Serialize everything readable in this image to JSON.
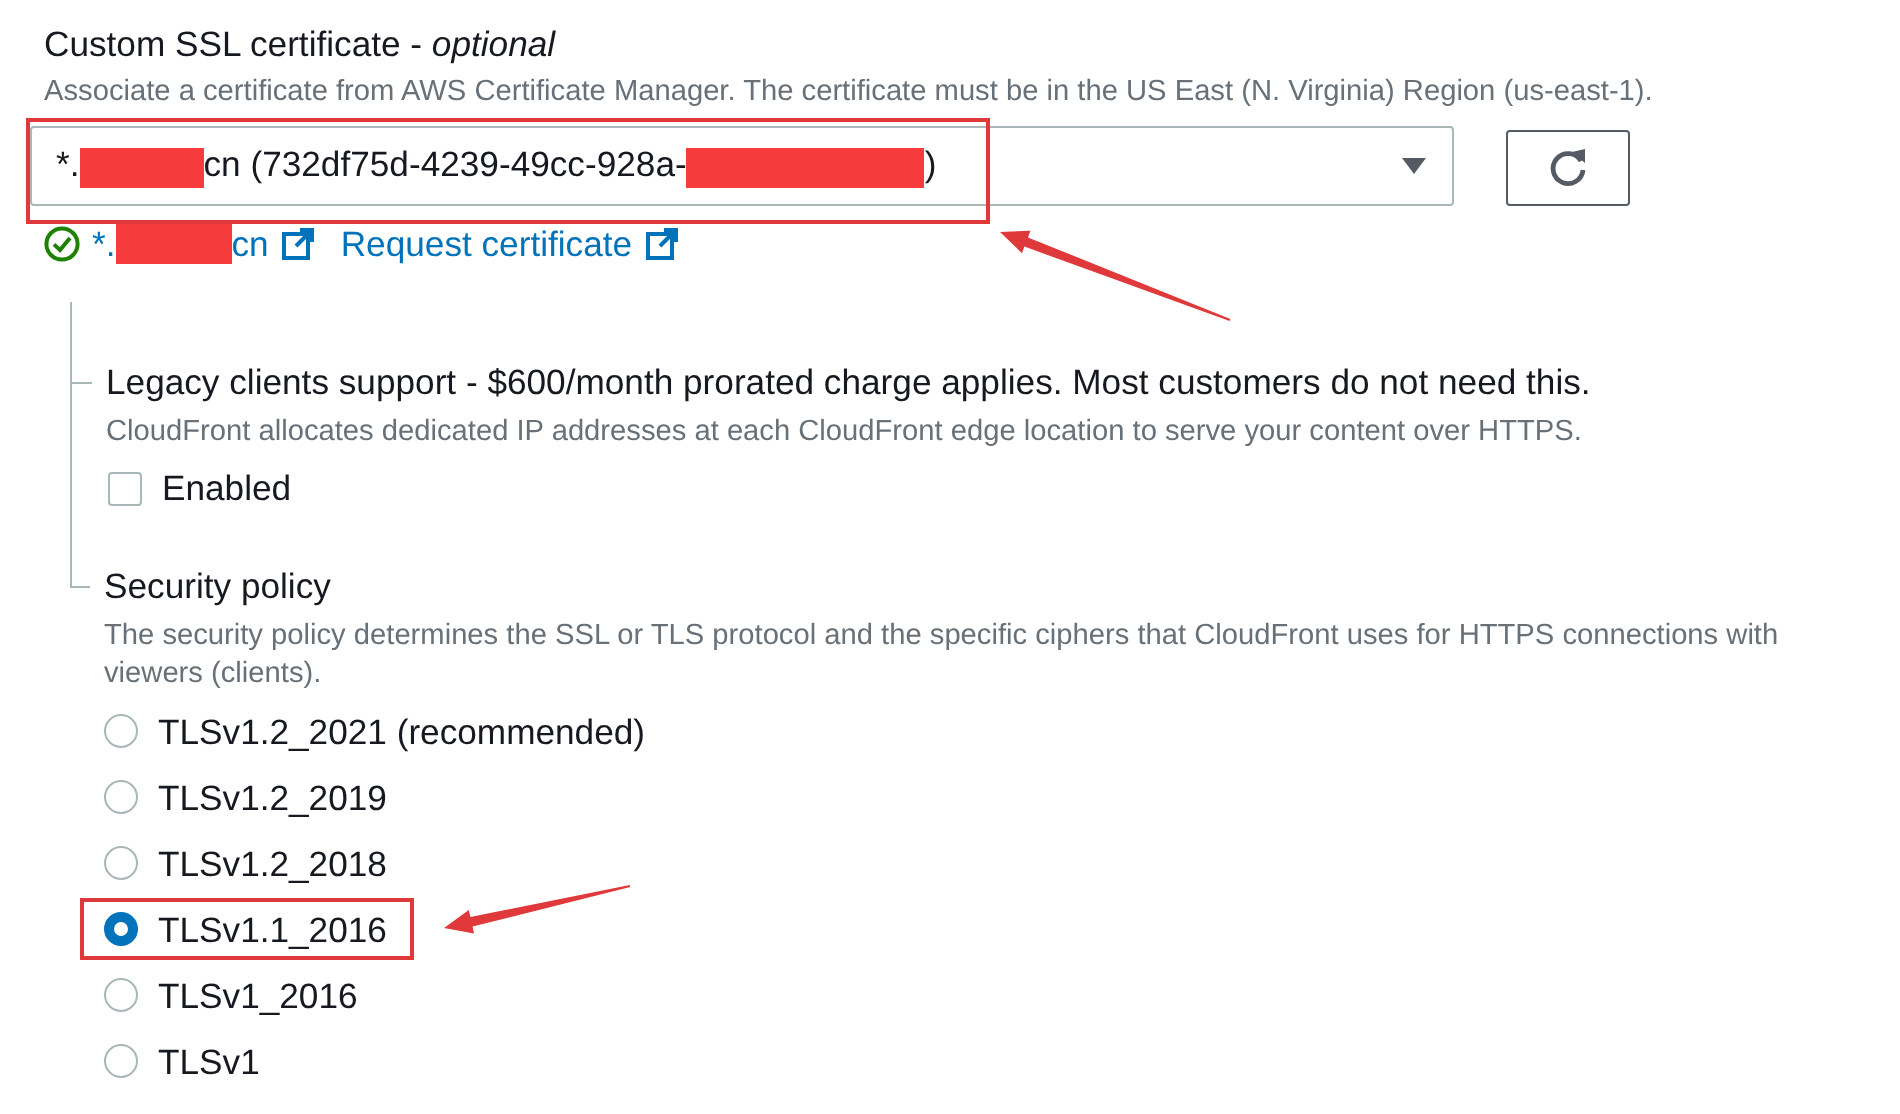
{
  "ssl_certificate": {
    "label": "Custom SSL certificate - *optional*",
    "description": "Associate a certificate from AWS Certificate Manager. The certificate must be in the US East (N. Virginia) Region (us-east-1).",
    "dropdown": {
      "highlighted": true,
      "value": [
        {
          "kind": "text",
          "text": "*."
        },
        {
          "kind": "redaction"
        },
        {
          "kind": "text",
          "text": "cn (732df75d-4239-49cc-928a-"
        },
        {
          "kind": "redaction"
        },
        {
          "kind": "text",
          "text": ")"
        }
      ]
    },
    "status": {
      "certificate": [
        {
          "kind": "text",
          "text": "*."
        },
        {
          "kind": "redaction"
        },
        {
          "kind": "text",
          "text": "cn"
        }
      ],
      "request_link": "Request certificate"
    }
  },
  "legacy_clients": {
    "label": "Legacy clients support - $600/month prorated charge applies. Most customers do not need this.",
    "description": "CloudFront allocates dedicated IP addresses at each CloudFront edge location to serve your content over HTTPS.",
    "checkbox": {
      "label": "Enabled",
      "checked": false
    }
  },
  "security_policy": {
    "label": "Security policy",
    "description": "The security policy determines the SSL or TLS protocol and the specific ciphers that CloudFront uses for HTTPS connections with viewers (clients).",
    "options": [
      {
        "label": "TLSv1.2_2021 (recommended)",
        "selected": false,
        "highlighted": false
      },
      {
        "label": "TLSv1.2_2019",
        "selected": false,
        "highlighted": false
      },
      {
        "label": "TLSv1.2_2018",
        "selected": false,
        "highlighted": false
      },
      {
        "label": "TLSv1.1_2016",
        "selected": true,
        "highlighted": true
      },
      {
        "label": "TLSv1_2016",
        "selected": false,
        "highlighted": false
      },
      {
        "label": "TLSv1",
        "selected": false,
        "highlighted": false
      }
    ]
  }
}
